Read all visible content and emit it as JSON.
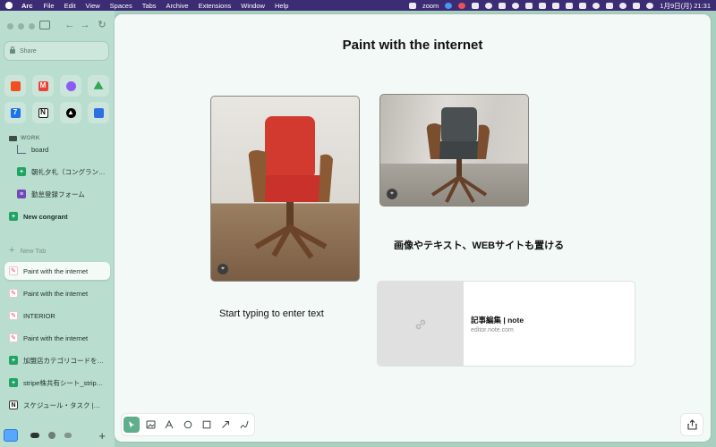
{
  "menubar": {
    "app": "Arc",
    "items": [
      "File",
      "Edit",
      "View",
      "Spaces",
      "Tabs",
      "Archive",
      "Extensions",
      "Window",
      "Help"
    ],
    "zoom_label": "zoom",
    "datetime": "1月9日(月)  21:31"
  },
  "sidebar": {
    "share_label": "Share",
    "favorites": [
      {
        "icon": "figma-icon",
        "color": "#f24e1e"
      },
      {
        "icon": "gmail-icon",
        "color": "#ea4335"
      },
      {
        "icon": "messenger-icon",
        "color": "#8a5cf6"
      },
      {
        "icon": "google-drive-icon",
        "color": "#34a853"
      },
      {
        "icon": "calendar-icon",
        "color": "#1a73e8"
      },
      {
        "icon": "notion-icon",
        "color": "#111111"
      },
      {
        "icon": "vercel-icon",
        "color": "#000000"
      },
      {
        "icon": "app-blue-icon",
        "color": "#2f6fe4"
      }
    ],
    "section_label": "WORK",
    "folder_items": [
      {
        "label": "board",
        "icon": "board-icon"
      },
      {
        "label": "朝礼夕礼（コングラン…",
        "icon": "google-sheets-icon"
      },
      {
        "label": "勤怠登録フォーム",
        "icon": "google-forms-icon"
      }
    ],
    "folder_name": "New congrant",
    "new_tab_label": "New Tab",
    "tabs": [
      {
        "label": "Paint with the internet",
        "icon": "arc-easel-icon",
        "active": true
      },
      {
        "label": "Paint with the internet",
        "icon": "arc-easel-icon",
        "active": false
      },
      {
        "label": "INTERIOR",
        "icon": "arc-easel-icon",
        "active": false
      },
      {
        "label": "Paint with the internet",
        "icon": "arc-easel-icon",
        "active": false
      },
      {
        "label": "加盟店カテゴリコードを…",
        "icon": "google-sheets-icon",
        "active": false
      },
      {
        "label": "stripe株共有シート_strip…",
        "icon": "google-sheets-icon",
        "active": false
      },
      {
        "label": "スケジュール・タスク |…",
        "icon": "notion-icon",
        "active": false
      }
    ]
  },
  "canvas": {
    "title": "Paint with the internet",
    "text_block_1": "画像やテキスト、WEBサイトも置ける",
    "text_block_2": "Start typing to enter text",
    "link_card": {
      "title": "記事編集 | note",
      "url": "editor.note.com"
    },
    "tools": [
      "select-tool-icon",
      "image-tool-icon",
      "pen-tool-icon",
      "circle-tool-icon",
      "square-tool-icon",
      "arrow-tool-icon",
      "scribble-tool-icon"
    ],
    "active_tool": "select-tool-icon"
  }
}
